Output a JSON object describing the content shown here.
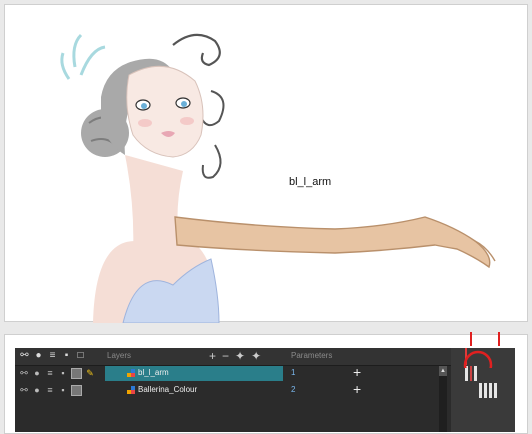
{
  "stage": {
    "layer_label": "bl_l_arm"
  },
  "timeline": {
    "header": {
      "layers_label": "Layers",
      "parameters_label": "Parameters",
      "tools": [
        "+",
        "−",
        "✦",
        "✦"
      ]
    },
    "layers": [
      {
        "name": "bl_l_arm",
        "selected": true,
        "parameter": "1"
      },
      {
        "name": "Ballerina_Colour",
        "selected": false,
        "parameter": "2"
      }
    ],
    "annotation_color": "#e02020",
    "selection_color": "#2a7e8a"
  }
}
